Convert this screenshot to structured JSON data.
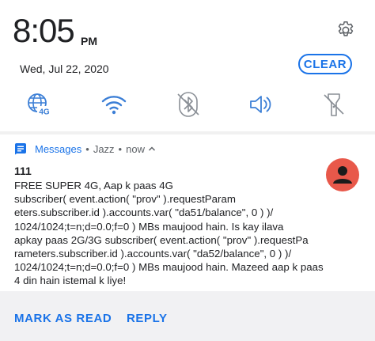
{
  "status": {
    "time": "8:05",
    "ampm": "PM",
    "date": "Wed, Jul 22, 2020",
    "clear_label": "CLEAR"
  },
  "quick_settings": [
    {
      "name": "mobile-data-4g",
      "badge": "4G",
      "state": "on"
    },
    {
      "name": "wifi",
      "state": "on"
    },
    {
      "name": "bluetooth",
      "state": "off"
    },
    {
      "name": "sound",
      "state": "on"
    },
    {
      "name": "flashlight",
      "state": "off"
    }
  ],
  "notification": {
    "app": "Messages",
    "source": "Jazz",
    "time": "now",
    "sender": "111",
    "body_lines": [
      "FREE SUPER 4G, Aap k paas 4G",
      "subscriber( event.action( \"prov\" ).requestParam",
      "eters.subscriber.id ).accounts.var( \"da51/balance\", 0 ) )/",
      "1024/1024;t=n;d=0.0;f=0 ) MBs maujood hain. Is kay ilava",
      "apkay paas 2G/3G subscriber( event.action( \"prov\" ).requestPa",
      "rameters.subscriber.id ).accounts.var( \"da52/balance\", 0 ) )/",
      "1024/1024;t=n;d=0.0;f=0 ) MBs maujood hain. Mazeed aap k paas",
      "4 din hain istemal k liye!"
    ],
    "actions": {
      "mark_read": "MARK AS READ",
      "reply": "REPLY"
    }
  },
  "colors": {
    "accent": "#1a73e8",
    "icon": "#3c7fd6",
    "icon_off": "#8a8f96",
    "avatar_bg": "#e8584a"
  }
}
